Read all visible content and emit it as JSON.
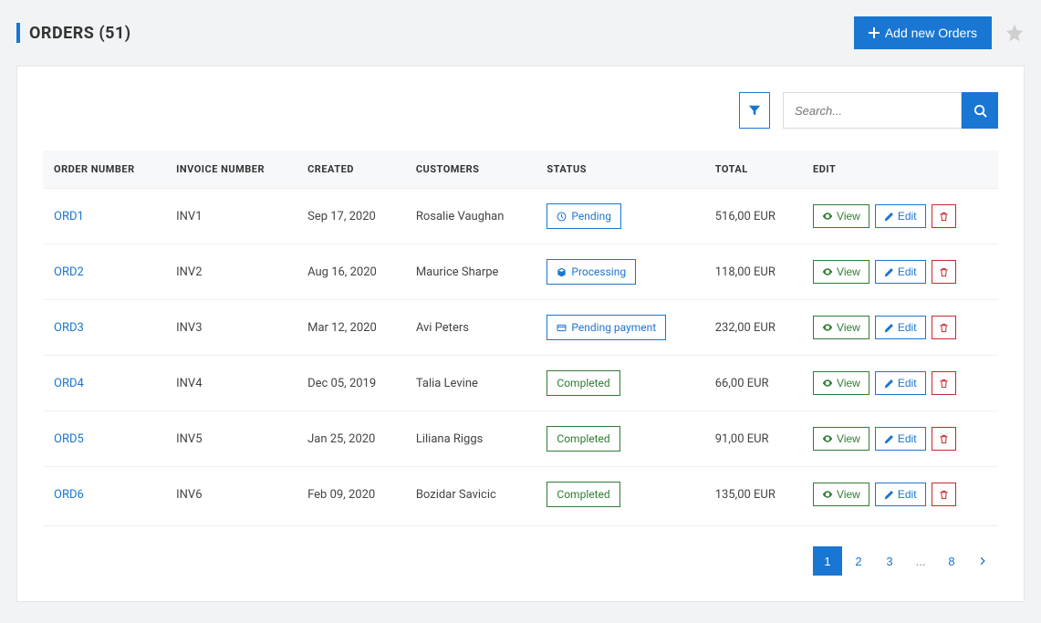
{
  "header": {
    "title": "ORDERS (51)",
    "add_button": "Add new Orders"
  },
  "toolbar": {
    "search_placeholder": "Search..."
  },
  "columns": {
    "order_number": "ORDER NUMBER",
    "invoice_number": "INVOICE NUMBER",
    "created": "CREATED",
    "customers": "CUSTOMERS",
    "status": "STATUS",
    "total": "TOTAL",
    "edit": "EDIT"
  },
  "actions": {
    "view": "View",
    "edit": "Edit"
  },
  "rows": [
    {
      "order": "ORD1",
      "invoice": "INV1",
      "created": "Sep 17, 2020",
      "customer": "Rosalie Vaughan",
      "status": "Pending",
      "status_style": "blue",
      "status_icon": "clock",
      "total": "516,00 EUR"
    },
    {
      "order": "ORD2",
      "invoice": "INV2",
      "created": "Aug 16, 2020",
      "customer": "Maurice Sharpe",
      "status": "Processing",
      "status_style": "blue",
      "status_icon": "cube",
      "total": "118,00 EUR"
    },
    {
      "order": "ORD3",
      "invoice": "INV3",
      "created": "Mar 12, 2020",
      "customer": "Avi Peters",
      "status": "Pending payment",
      "status_style": "blue",
      "status_icon": "card",
      "total": "232,00 EUR"
    },
    {
      "order": "ORD4",
      "invoice": "INV4",
      "created": "Dec 05, 2019",
      "customer": "Talia Levine",
      "status": "Completed",
      "status_style": "green",
      "status_icon": "",
      "total": "66,00 EUR"
    },
    {
      "order": "ORD5",
      "invoice": "INV5",
      "created": "Jan 25, 2020",
      "customer": "Liliana Riggs",
      "status": "Completed",
      "status_style": "green",
      "status_icon": "",
      "total": "91,00 EUR"
    },
    {
      "order": "ORD6",
      "invoice": "INV6",
      "created": "Feb 09, 2020",
      "customer": "Bozidar Savicic",
      "status": "Completed",
      "status_style": "green",
      "status_icon": "",
      "total": "135,00 EUR"
    }
  ],
  "pagination": {
    "pages": [
      "1",
      "2",
      "3",
      "...",
      "8"
    ],
    "active": "1"
  }
}
